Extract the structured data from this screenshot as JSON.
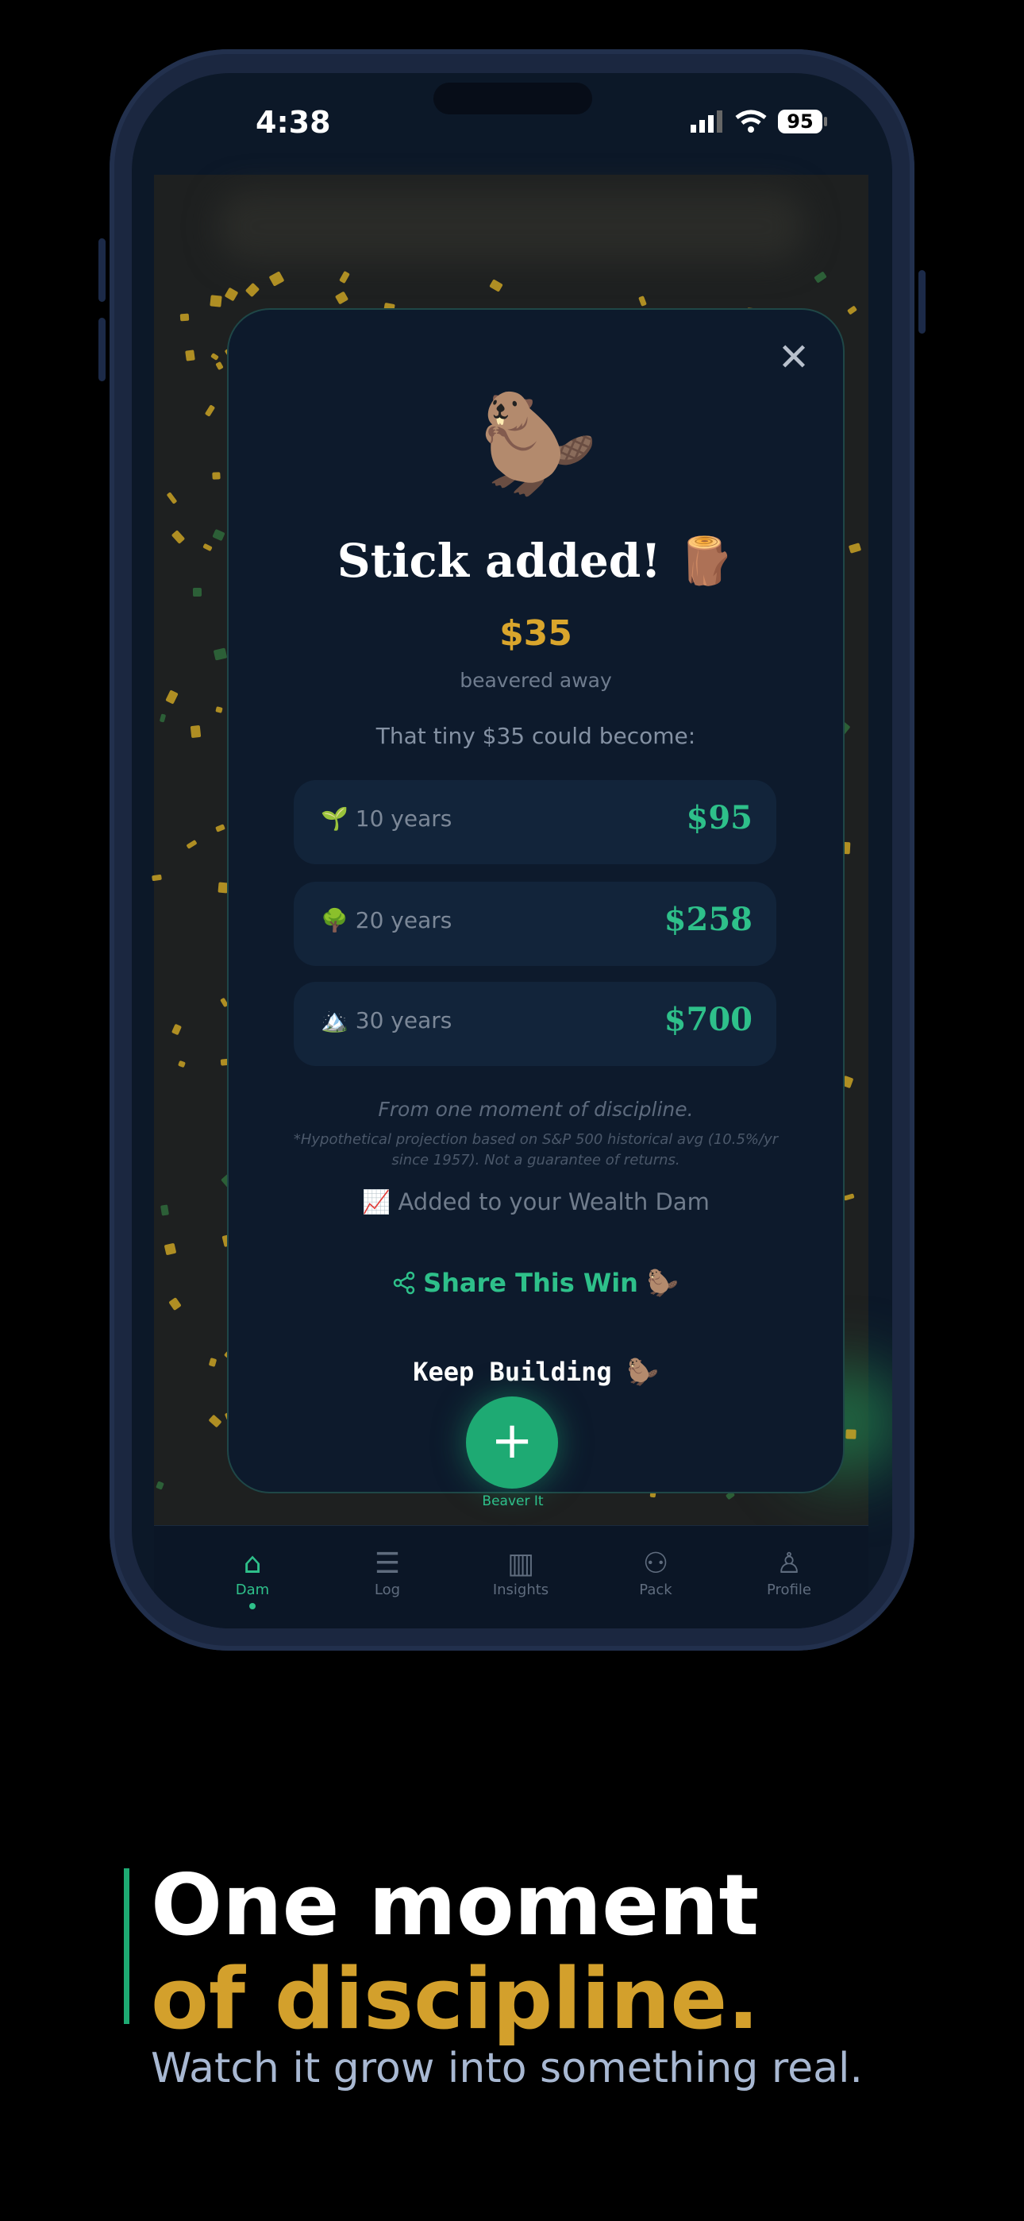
{
  "status_bar": {
    "time": "4:38",
    "battery": "95"
  },
  "modal": {
    "close_icon": "close-icon",
    "beaver_emoji": "🦫",
    "title": "Stick added! 🪵",
    "amount": "$35",
    "amount_caption": "beavered away",
    "intro": "That tiny $35 could become:",
    "projections": [
      {
        "icon": "🌱",
        "label": "10 years",
        "value": "$95"
      },
      {
        "icon": "🌳",
        "label": "20 years",
        "value": "$258"
      },
      {
        "icon": "🏔️",
        "label": "30 years",
        "value": "$700"
      }
    ],
    "discipline_line": "From one moment of discipline.",
    "footnote": "*Hypothetical projection based on S&P 500 historical avg (10.5%/yr since 1957). Not a guarantee of returns.",
    "added_line": "📈 Added to your Wealth Dam",
    "share_label": "Share This Win 🦫",
    "keep_label": "Keep Building 🦫"
  },
  "fab": {
    "symbol": "+",
    "label": "Beaver It"
  },
  "tabs": [
    {
      "label": "Dam",
      "icon": "home-icon",
      "glyph": "⌂",
      "active": true
    },
    {
      "label": "Log",
      "icon": "list-icon",
      "glyph": "☰",
      "active": false
    },
    {
      "label": "Insights",
      "icon": "chart-icon",
      "glyph": "▥",
      "active": false
    },
    {
      "label": "Pack",
      "icon": "users-icon",
      "glyph": "⚇",
      "active": false
    },
    {
      "label": "Profile",
      "icon": "user-icon",
      "glyph": "♙",
      "active": false
    }
  ],
  "marketing": {
    "headline_1": "One moment",
    "headline_2": "of discipline.",
    "tagline": "Watch it grow into something real."
  },
  "colors": {
    "accent_green": "#2ec08a",
    "gold": "#d9a52c",
    "background": "#000000"
  }
}
